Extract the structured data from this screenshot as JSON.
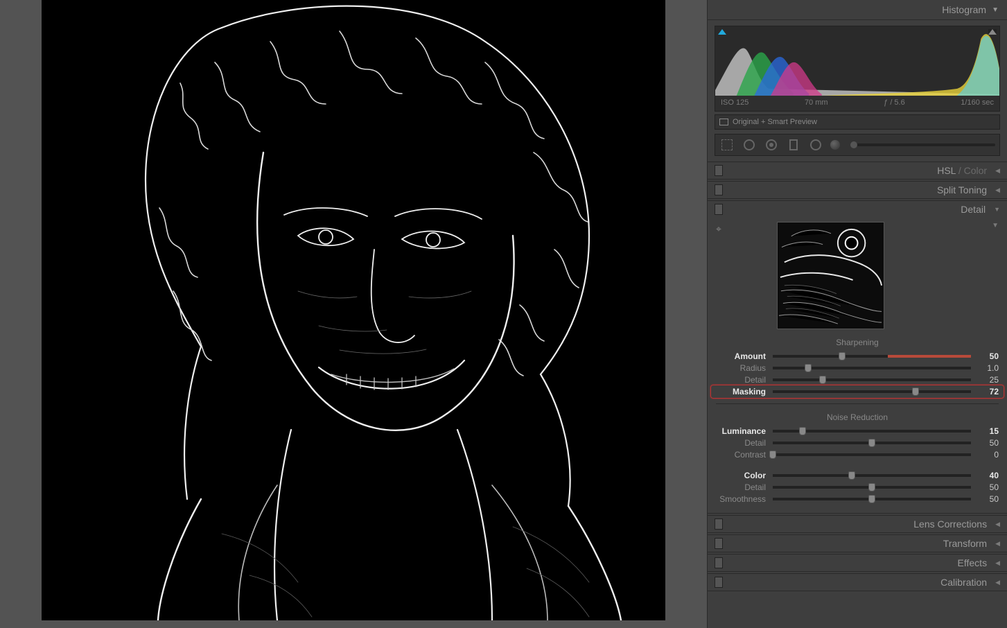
{
  "panel": {
    "title": "Histogram"
  },
  "meta": {
    "iso": "ISO 125",
    "focal": "70 mm",
    "aperture": "ƒ / 5.6",
    "shutter": "1/160 sec"
  },
  "preview": {
    "label": "Original + Smart Preview"
  },
  "sections": {
    "hsl_label_a": "HSL",
    "hsl_label_b": " / Color",
    "split_toning": "Split Toning",
    "detail": "Detail",
    "lens": "Lens Corrections",
    "transform": "Transform",
    "effects": "Effects",
    "calibration": "Calibration"
  },
  "sharpening": {
    "title": "Sharpening",
    "amount": {
      "label": "Amount",
      "value": "50",
      "pct": 35,
      "redfill": 42
    },
    "radius": {
      "label": "Radius",
      "value": "1.0",
      "pct": 18
    },
    "detail": {
      "label": "Detail",
      "value": "25",
      "pct": 25
    },
    "masking": {
      "label": "Masking",
      "value": "72",
      "pct": 72
    }
  },
  "noise": {
    "title": "Noise Reduction",
    "luminance": {
      "label": "Luminance",
      "value": "15",
      "pct": 15
    },
    "detail": {
      "label": "Detail",
      "value": "50",
      "pct": 50
    },
    "contrast": {
      "label": "Contrast",
      "value": "0",
      "pct": 0
    },
    "color": {
      "label": "Color",
      "value": "40",
      "pct": 40
    },
    "cdetail": {
      "label": "Detail",
      "value": "50",
      "pct": 50
    },
    "smoothness": {
      "label": "Smoothness",
      "value": "50",
      "pct": 50
    }
  }
}
